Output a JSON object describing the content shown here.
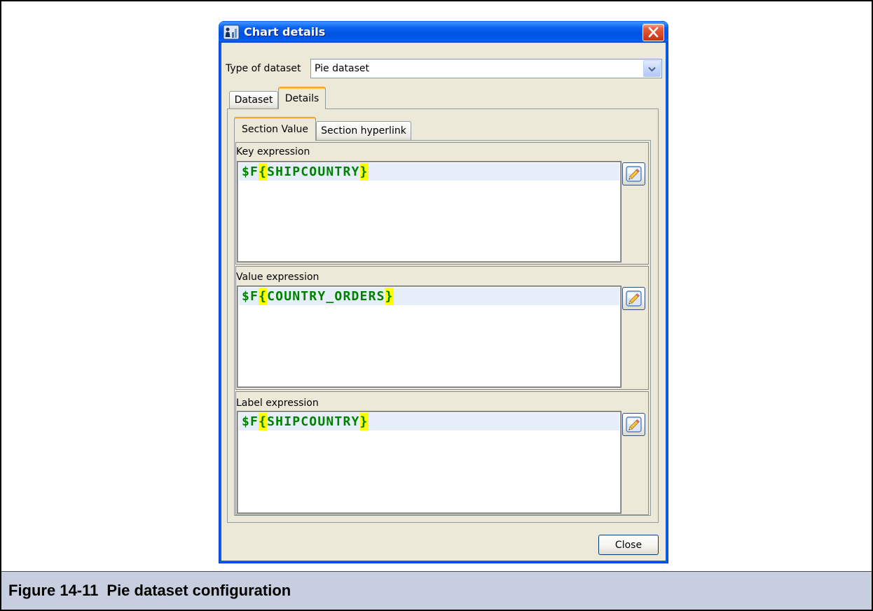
{
  "window": {
    "title": "Chart details",
    "app_icon": "chart-report-icon",
    "close_icon": "close-icon"
  },
  "dataset_type": {
    "label": "Type of dataset",
    "selected": "Pie dataset",
    "dropdown_icon": "chevron-down-icon"
  },
  "tabs": [
    {
      "label": "Dataset",
      "selected": false
    },
    {
      "label": "Details",
      "selected": true
    }
  ],
  "details": {
    "tabs": [
      {
        "label": "Section Value",
        "selected": true
      },
      {
        "label": "Section hyperlink",
        "selected": false
      }
    ],
    "expressions": [
      {
        "label": "Key expression",
        "value": "$F{SHIPCOUNTRY}",
        "edit_icon": "pencil-edit-icon"
      },
      {
        "label": "Value expression",
        "value": "$F{COUNTRY_ORDERS}",
        "edit_icon": "pencil-edit-icon"
      },
      {
        "label": "Label expression",
        "value": "$F{SHIPCOUNTRY}",
        "edit_icon": "pencil-edit-icon"
      }
    ]
  },
  "footer": {
    "close_label": "Close"
  },
  "caption": {
    "number": "Figure 14-11",
    "title": "Pie dataset configuration"
  },
  "colors": {
    "title_bar": "#0054e3",
    "selected_tab_accent": "#ffc73c",
    "expression_text": "#008000",
    "brace_highlight": "#ffff00",
    "current_line": "#e6eefa",
    "caption_background": "#c6cedf",
    "close_button": "#d8492a"
  }
}
